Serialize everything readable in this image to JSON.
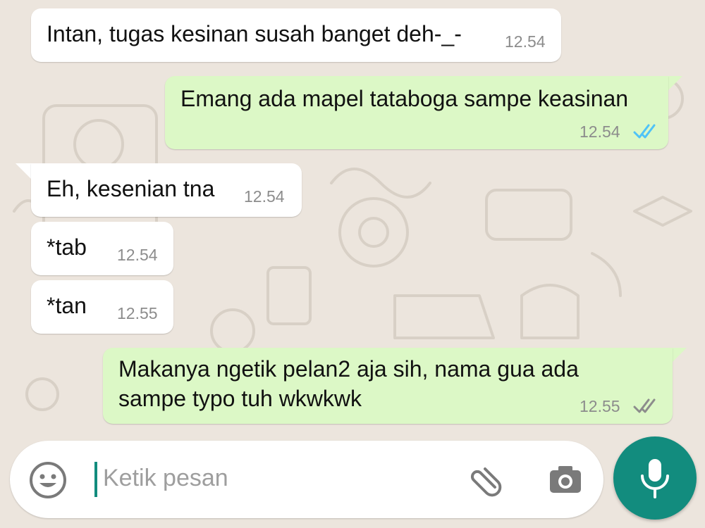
{
  "chat": {
    "messages": [
      {
        "direction": "in",
        "text": "Intan, tugas kesinan susah banget deh-_-",
        "time": "12.54"
      },
      {
        "direction": "out",
        "text": "Emang ada mapel tataboga sampe keasinan",
        "time": "12.54",
        "status": "read"
      },
      {
        "direction": "in",
        "text": "Eh, kesenian tna",
        "time": "12.54"
      },
      {
        "direction": "in",
        "text": "*tab",
        "time": "12.54"
      },
      {
        "direction": "in",
        "text": "*tan",
        "time": "12.55"
      },
      {
        "direction": "out",
        "text_lines": [
          "Makanya ngetik pelan2 aja sih, nama gua ada",
          "sampe typo tuh wkwkwk"
        ],
        "time": "12.55",
        "status": "delivered"
      }
    ]
  },
  "composer": {
    "placeholder": "Ketik pesan",
    "icons": {
      "emoji": "emoji-icon",
      "attach": "paperclip-icon",
      "camera": "camera-icon",
      "mic": "mic-icon"
    }
  },
  "colors": {
    "background": "#ece5dd",
    "incoming_bubble": "#ffffff",
    "outgoing_bubble": "#dcf8c6",
    "read_tick": "#4fc3f7",
    "delivered_tick": "#8c8c8c",
    "accent": "#128c7e"
  }
}
